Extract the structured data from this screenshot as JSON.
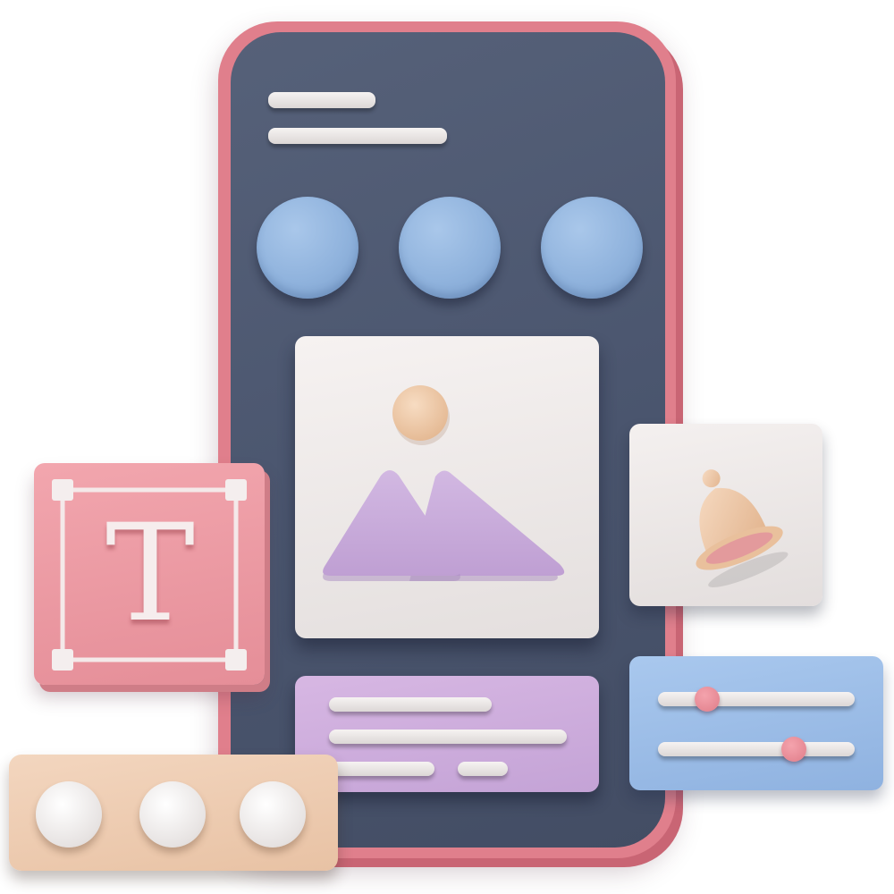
{
  "text_tool": {
    "glyph": "T"
  },
  "sliders": [
    {
      "value": 0.25
    },
    {
      "value": 0.69
    }
  ],
  "pagination": {
    "count": 3
  },
  "colors": {
    "phone_frame": "#e07f8c",
    "screen": "#4f5a72",
    "circle_buttons": "#90b3dd",
    "image_card": "#efebea",
    "mountains": "#c5a8d8",
    "sun": "#eec9a9",
    "text_card": "#d0b0e0",
    "text_tool_card": "#ec9aa3",
    "slider_card": "#9fc0ea",
    "slider_handle": "#e8848f",
    "pagination_card": "#f0cfb5",
    "bell": "#f0c8a8"
  },
  "icons": [
    "image-icon",
    "bell-icon",
    "text-tool-icon",
    "slider-icon"
  ]
}
